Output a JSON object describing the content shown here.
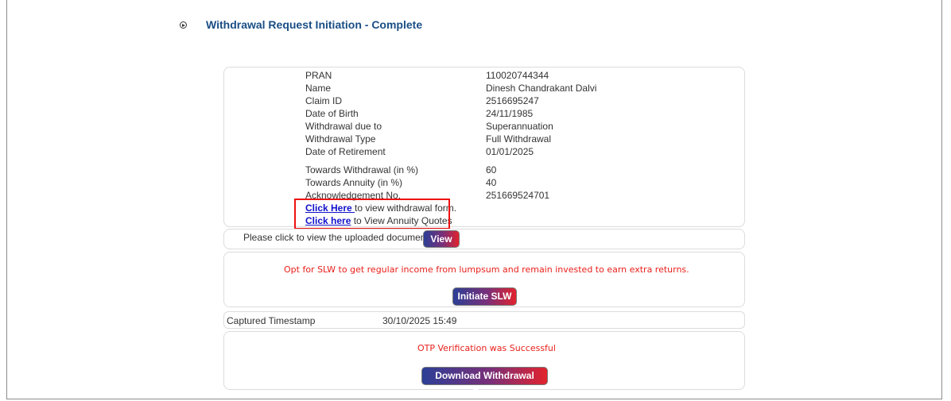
{
  "header": {
    "title": "Withdrawal Request Initiation - Complete"
  },
  "details": [
    {
      "label": "PRAN",
      "value": "110020744344"
    },
    {
      "label": "Name",
      "value": "Dinesh Chandrakant Dalvi"
    },
    {
      "label": "Claim ID",
      "value": "2516695247"
    },
    {
      "label": "Date of Birth",
      "value": "24/11/1985"
    },
    {
      "label": "Withdrawal due to",
      "value": "Superannuation"
    },
    {
      "label": "Withdrawal Type",
      "value": "Full Withdrawal"
    },
    {
      "label": "Date of Retirement",
      "value": "01/01/2025"
    },
    {
      "label": "Towards Withdrawal (in %)",
      "value": "60"
    },
    {
      "label": "Towards Annuity (in %)",
      "value": "40"
    },
    {
      "label": "Acknowledgement No.",
      "value": "251669524701"
    }
  ],
  "links": {
    "form_link": "Click Here ",
    "form_text": "to view withdrawal form.",
    "annuity_link": "Click here",
    "annuity_text": " to View Annuity Quotes"
  },
  "upload": {
    "text": "Please click to view the uploaded document :",
    "button": "View"
  },
  "slw": {
    "text": "Opt for SLW to get regular income from lumpsum and remain invested to earn extra returns.",
    "button": "Initiate SLW"
  },
  "timestamp": {
    "label": "Captured Timestamp",
    "value": "30/10/2025 15:49"
  },
  "otp": {
    "text": "OTP Verification was Successful",
    "button": "Download Withdrawal Form"
  },
  "colors": {
    "title": "#1a4e85",
    "alert": "#e8201b",
    "highlight": "#e11111",
    "link": "#1111cc"
  }
}
